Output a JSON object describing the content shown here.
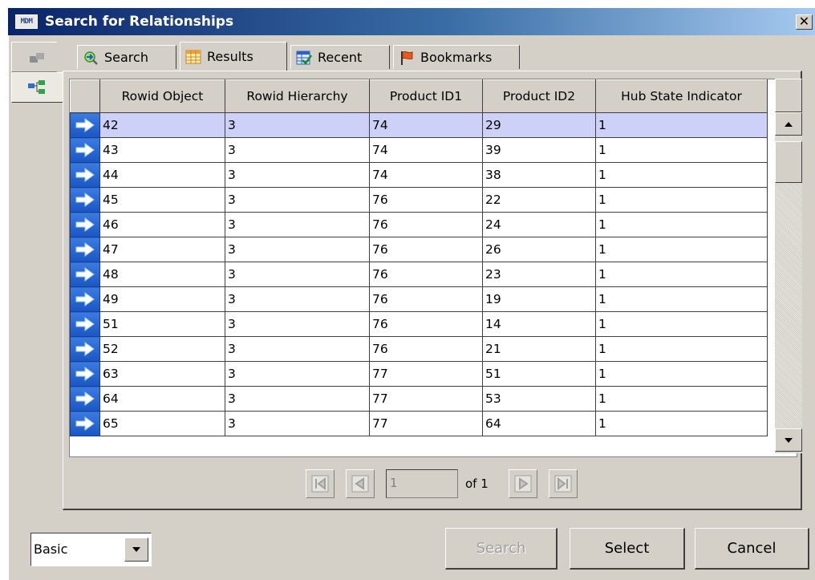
{
  "window": {
    "title": "Search for Relationships",
    "logo_text": "MDM",
    "close_label": "✕"
  },
  "tabs": [
    {
      "label": "Search",
      "icon": "search-arrow-icon",
      "active": false
    },
    {
      "label": "Results",
      "icon": "grid-table-icon",
      "active": true
    },
    {
      "label": "Recent",
      "icon": "recent-checklist-icon",
      "active": false
    },
    {
      "label": "Bookmarks",
      "icon": "flag-icon",
      "active": false
    }
  ],
  "side_tabs": [
    {
      "icon": "entity-icon",
      "active": false
    },
    {
      "icon": "hierarchy-icon",
      "active": true
    }
  ],
  "grid": {
    "columns": [
      "Rowid Object",
      "Rowid Hierarchy",
      "Product ID1",
      "Product ID2",
      "Hub State Indicator"
    ],
    "rows": [
      [
        "42",
        "3",
        "74",
        "29",
        "1"
      ],
      [
        "43",
        "3",
        "74",
        "39",
        "1"
      ],
      [
        "44",
        "3",
        "74",
        "38",
        "1"
      ],
      [
        "45",
        "3",
        "76",
        "22",
        "1"
      ],
      [
        "46",
        "3",
        "76",
        "24",
        "1"
      ],
      [
        "47",
        "3",
        "76",
        "26",
        "1"
      ],
      [
        "48",
        "3",
        "76",
        "23",
        "1"
      ],
      [
        "49",
        "3",
        "76",
        "19",
        "1"
      ],
      [
        "51",
        "3",
        "76",
        "14",
        "1"
      ],
      [
        "52",
        "3",
        "76",
        "21",
        "1"
      ],
      [
        "63",
        "3",
        "77",
        "51",
        "1"
      ],
      [
        "64",
        "3",
        "77",
        "53",
        "1"
      ],
      [
        "65",
        "3",
        "77",
        "64",
        "1"
      ]
    ],
    "selected_row": 0
  },
  "pager": {
    "page": "1",
    "of_label": "of 1"
  },
  "bottom": {
    "mode_value": "Basic",
    "search_label": "Search",
    "select_label": "Select",
    "cancel_label": "Cancel"
  },
  "colors": {
    "title_gradient_start": "#0a246a",
    "selected_row": "#cdd1f8",
    "row_arrow": "#1a56c5",
    "face": "#d4d0c8"
  }
}
